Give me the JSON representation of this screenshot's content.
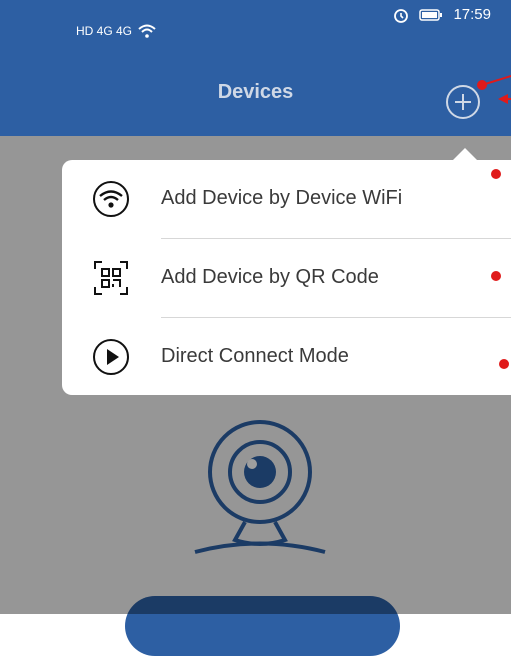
{
  "status_bar": {
    "left_text": "HD 4G 4G",
    "time": "17:59"
  },
  "header": {
    "title": "Devices"
  },
  "menu": {
    "items": [
      {
        "label": "Add Device by Device WiFi",
        "icon": "wifi-icon"
      },
      {
        "label": "Add Device by QR Code",
        "icon": "qr-code-icon"
      },
      {
        "label": "Direct Connect Mode",
        "icon": "play-icon"
      }
    ]
  },
  "colors": {
    "primary": "#2d5fa3",
    "annotation": "#e01a1a"
  }
}
